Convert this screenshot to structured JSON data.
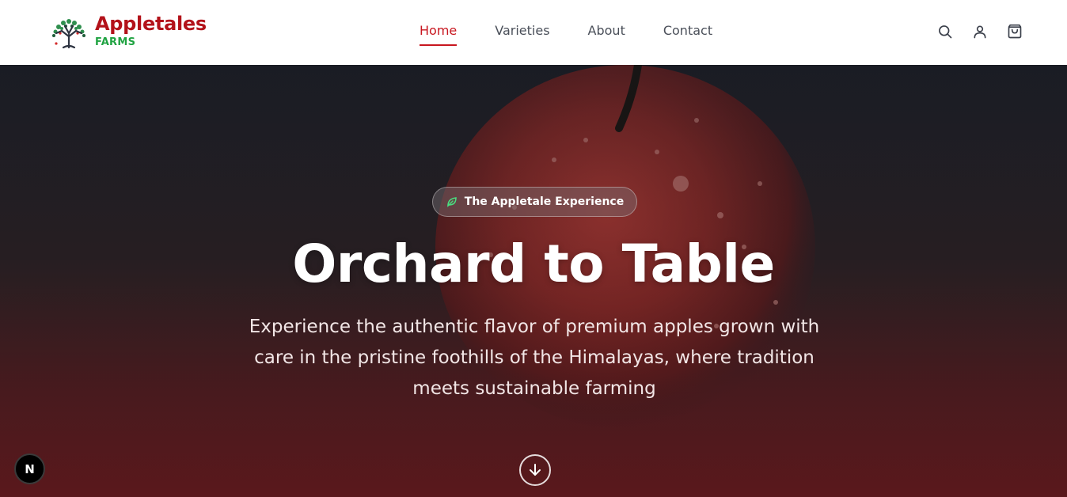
{
  "brand": {
    "name": "Appletales",
    "sub": "FARMS",
    "logo_icon": "tree-logo-icon"
  },
  "nav": {
    "items": [
      {
        "label": "Home",
        "active": true
      },
      {
        "label": "Varieties",
        "active": false
      },
      {
        "label": "About",
        "active": false
      },
      {
        "label": "Contact",
        "active": false
      }
    ]
  },
  "header_icons": [
    "search-icon",
    "user-icon",
    "cart-icon"
  ],
  "hero": {
    "badge": "The Appletale Experience",
    "badge_icon": "leaf-icon",
    "title": "Orchard to Table",
    "subtitle": "Experience the authentic flavor of premium apples grown with care in the pristine foothills of the Himalayas, where tradition meets sustainable farming",
    "scroll_icon": "arrow-down-icon"
  },
  "dev_badge": {
    "label": "N"
  },
  "colors": {
    "brand_red": "#b3121a",
    "brand_green": "#20a342",
    "nav_active": "#c8161f",
    "nav_text": "#4a4f59"
  }
}
